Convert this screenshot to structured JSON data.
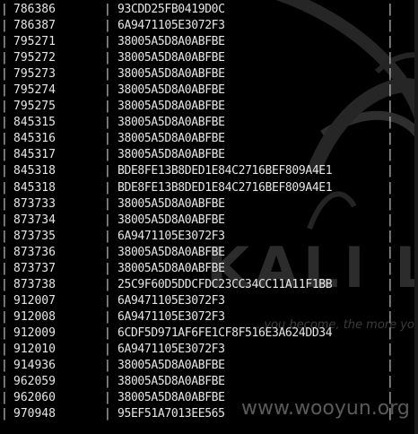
{
  "wallpaper": {
    "logo_text": "KALI LIN",
    "tagline": "...you become, the more yo"
  },
  "watermark": "www.wooyun.org",
  "table": {
    "rows": [
      {
        "id": "786386",
        "hash": "93CDD25FB0419D0C"
      },
      {
        "id": "786387",
        "hash": "6A9471105E3072F3"
      },
      {
        "id": "795271",
        "hash": "38005A5D8A0ABFBE"
      },
      {
        "id": "795272",
        "hash": "38005A5D8A0ABFBE"
      },
      {
        "id": "795273",
        "hash": "38005A5D8A0ABFBE"
      },
      {
        "id": "795274",
        "hash": "38005A5D8A0ABFBE"
      },
      {
        "id": "795275",
        "hash": "38005A5D8A0ABFBE"
      },
      {
        "id": "845315",
        "hash": "38005A5D8A0ABFBE"
      },
      {
        "id": "845316",
        "hash": "38005A5D8A0ABFBE"
      },
      {
        "id": "845317",
        "hash": "38005A5D8A0ABFBE"
      },
      {
        "id": "845318",
        "hash": "BDE8FE13B8DED1E84C2716BEF809A4E1"
      },
      {
        "id": "845318",
        "hash": "BDE8FE13B8DED1E84C2716BEF809A4E1"
      },
      {
        "id": "873733",
        "hash": "38005A5D8A0ABFBE"
      },
      {
        "id": "873734",
        "hash": "38005A5D8A0ABFBE"
      },
      {
        "id": "873735",
        "hash": "6A9471105E3072F3"
      },
      {
        "id": "873736",
        "hash": "38005A5D8A0ABFBE"
      },
      {
        "id": "873737",
        "hash": "38005A5D8A0ABFBE"
      },
      {
        "id": "873738",
        "hash": "25C9F60D5DDCFDC23CC34CC11A11F1BB"
      },
      {
        "id": "912007",
        "hash": "6A9471105E3072F3"
      },
      {
        "id": "912008",
        "hash": "6A9471105E3072F3"
      },
      {
        "id": "912009",
        "hash": "6CDF5D971AF6FE1CF8F516E3A624DD34"
      },
      {
        "id": "912010",
        "hash": "6A9471105E3072F3"
      },
      {
        "id": "914936",
        "hash": "38005A5D8A0ABFBE"
      },
      {
        "id": "962059",
        "hash": "38005A5D8A0ABFBE"
      },
      {
        "id": "962060",
        "hash": "38005A5D8A0ABFBE"
      },
      {
        "id": "970948",
        "hash": "95EF51A7013EE565"
      }
    ],
    "separator": "|"
  },
  "colors": {
    "background": "#000000",
    "text": "#e6e6e6"
  }
}
